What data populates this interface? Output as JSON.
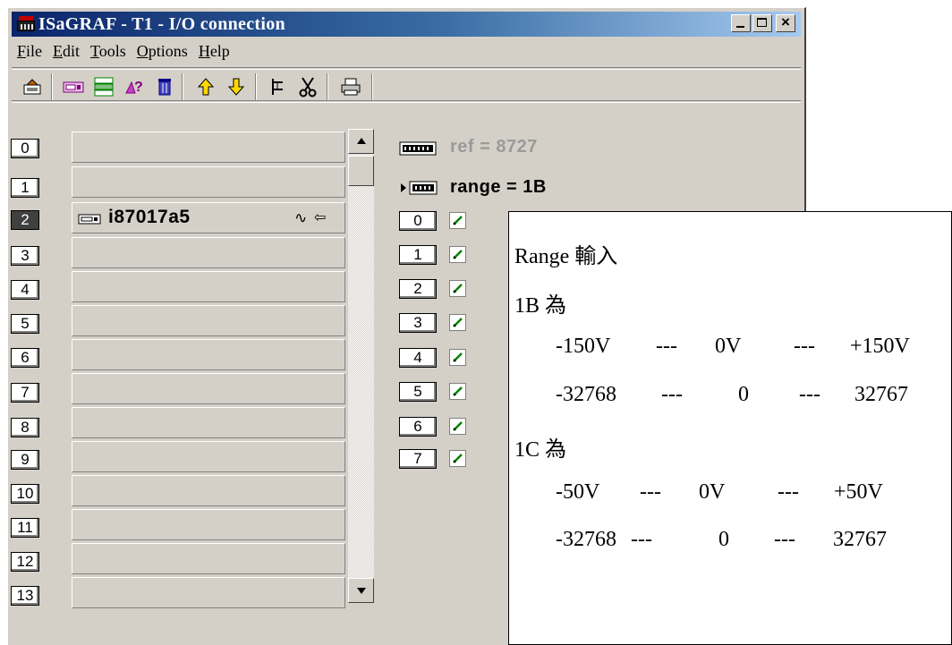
{
  "window": {
    "title": "ISaGRAF - T1 - I/O connection",
    "minimize_label": "_",
    "close_label": "×"
  },
  "menu": [
    {
      "mnemonic": "F",
      "rest": "ile"
    },
    {
      "mnemonic": "E",
      "rest": "dit"
    },
    {
      "mnemonic": "T",
      "rest": "ools"
    },
    {
      "mnemonic": "O",
      "rest": "ptions"
    },
    {
      "mnemonic": "H",
      "rest": "elp"
    }
  ],
  "toolbar": {
    "icons": [
      "open-board-icon",
      "board-icon",
      "board-list-icon",
      "board-help-icon",
      "delete-icon",
      "move-up-icon",
      "move-down-icon",
      "connect-icon",
      "disconnect-icon",
      "print-icon"
    ]
  },
  "slots": {
    "numbers": [
      "0",
      "1",
      "2",
      "3",
      "4",
      "5",
      "6",
      "7",
      "8",
      "9",
      "10",
      "11",
      "12",
      "13"
    ],
    "selected_index": 2,
    "board_name": "i87017a5",
    "board_wave": "∿",
    "board_arrow": "⇦"
  },
  "panel": {
    "ref": "ref = 8727",
    "range": "range = 1B",
    "channels": [
      "0",
      "1",
      "2",
      "3",
      "4",
      "5",
      "6",
      "7"
    ]
  },
  "note": {
    "title": "Range 輸入",
    "sections": [
      {
        "label": "1B 為",
        "voltage_row": [
          "-150V",
          "---",
          "0V",
          "---",
          "+150V"
        ],
        "raw_row": [
          "-32768",
          "---",
          "0",
          "---",
          "32767"
        ]
      },
      {
        "label": "1C 為",
        "voltage_row": [
          "-50V",
          "---",
          "0V",
          "---",
          "+50V"
        ],
        "raw_row": [
          "-32768",
          "---",
          "0",
          "---",
          "32767"
        ]
      }
    ]
  },
  "colors": {
    "title_bar_start": "#0a246a",
    "title_bar_end": "#a6caf0",
    "window_face": "#d4d0c8",
    "selected_slot": "#404040",
    "ref_text": "#9a9a9a"
  }
}
